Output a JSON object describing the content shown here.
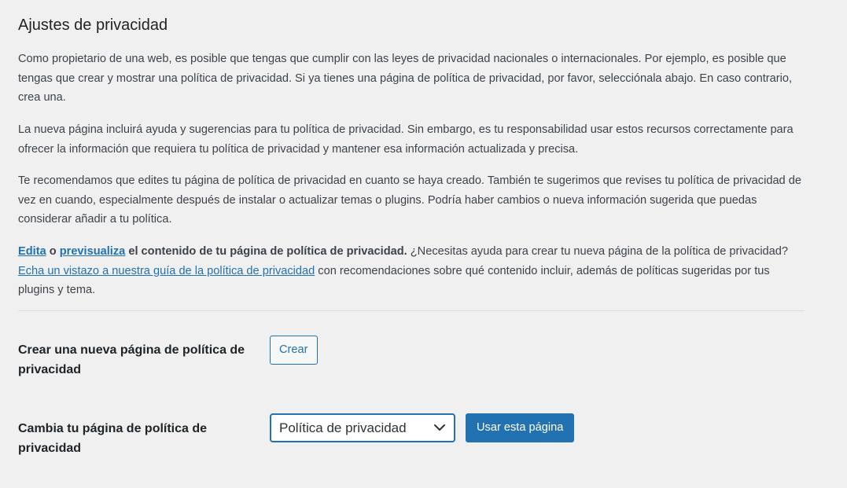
{
  "page": {
    "title": "Ajustes de privacidad"
  },
  "intro": {
    "p1": "Como propietario de una web, es posible que tengas que cumplir con las leyes de privacidad nacionales o internacionales. Por ejemplo, es posible que tengas que crear y mostrar una política de privacidad. Si ya tienes una página de política de privacidad, por favor, selecciónala abajo. En caso contrario, crea una.",
    "p2": "La nueva página incluirá ayuda y sugerencias para tu política de privacidad. Sin embargo, es tu responsabilidad usar estos recursos correctamente para ofrecer la información que requiera tu política de privacidad y mantener esa información actualizada y precisa.",
    "p3": "Te recomendamos que edites tu página de política de privacidad en cuanto se haya creado. También te sugerimos que revises tu política de privacidad de vez en cuando, especialmente después de instalar o actualizar temas o plugins. Podría haber cambios o nueva información sugerida que puedas considerar añadir a tu política."
  },
  "edit_line": {
    "edit_link": "Edita",
    "or_text": " o ",
    "preview_link": "previsualiza",
    "bold_text": " el contenido de tu página de política de privacidad.",
    "help_text": " ¿Necesitas ayuda para crear tu nueva página de la política de privacidad? ",
    "guide_link": "Echa un vistazo a nuestra guía de la política de privacidad",
    "tail_text": " con recomendaciones sobre qué contenido incluir, además de políticas sugeridas por tus plugins y tema."
  },
  "create_row": {
    "label": "Crear una nueva página de política de privacidad",
    "button": "Crear"
  },
  "change_row": {
    "label": "Cambia tu página de política de privacidad",
    "selected": "Política de privacidad",
    "button": "Usar esta página"
  },
  "colors": {
    "background": "#f0f0f1",
    "accent": "#2271b1",
    "text": "#3c434a"
  }
}
